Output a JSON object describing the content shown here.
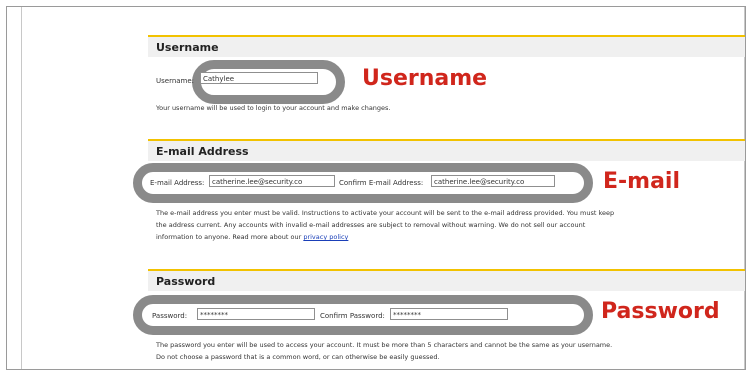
{
  "username": {
    "header": "Username",
    "label": "Username:",
    "value": "Cathylee",
    "description": "Your username will be used to login to your account and make changes.",
    "callout": "Username"
  },
  "email": {
    "header": "E-mail Address",
    "label": "E-mail Address:",
    "value": "catherine.lee@security.co",
    "confirm_label": "Confirm E-mail Address:",
    "confirm_value": "catherine.lee@security.co",
    "description_line1": "The e-mail address you enter must be valid. Instructions to activate your account will be sent to the e-mail address provided. You must keep",
    "description_line2": "the address current. Any accounts with invalid e-mail addresses are subject to removal without warning. We do not sell our account",
    "description_line3": "information to anyone. Read more about our",
    "privacy_link": "privacy policy",
    "callout": "E-mail"
  },
  "password": {
    "header": "Password",
    "label": "Password:",
    "value": "********",
    "confirm_label": "Confirm Password:",
    "confirm_value": "********",
    "description_line1": "The password you enter will be used to access your account. It must be more than 5 characters and cannot be the same as your username.",
    "description_line2": "Do not choose a password that is a common word, or can otherwise be easily guessed.",
    "callout": "Password"
  },
  "colors": {
    "accent_yellow": "#f2c200",
    "callout_red": "#d0261c",
    "highlight_gray": "#8a8a8a",
    "header_bg": "#f0f0f0",
    "link_blue": "#1a3fb8"
  }
}
